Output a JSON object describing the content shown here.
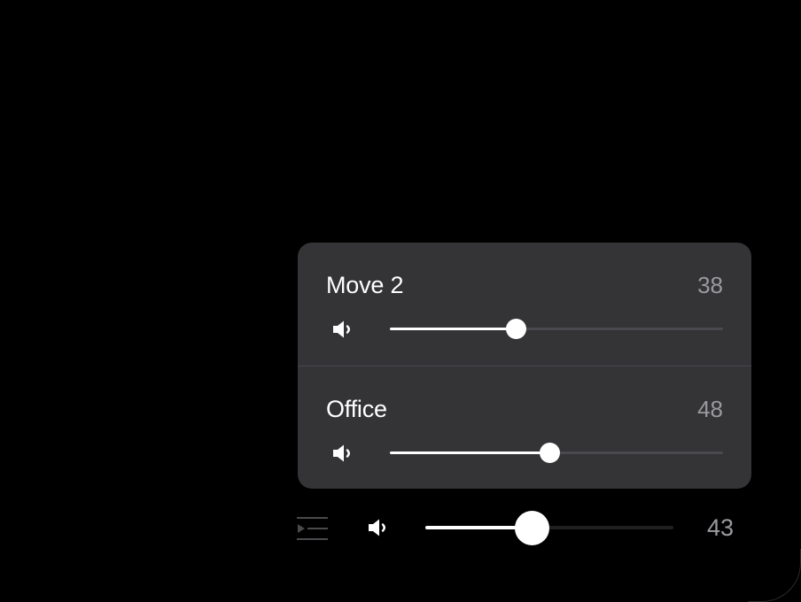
{
  "rooms": [
    {
      "name": "Move 2",
      "volume": "38",
      "level": 38
    },
    {
      "name": "Office",
      "volume": "48",
      "level": 48
    }
  ],
  "group": {
    "volume": "43",
    "level": 43
  },
  "icons": {
    "speaker": "speaker-icon",
    "queue": "queue-icon"
  },
  "colors": {
    "panel": "#343437",
    "track": "#4a4a4e",
    "thumb": "#ffffff",
    "muted_text": "#9a9a9e"
  }
}
